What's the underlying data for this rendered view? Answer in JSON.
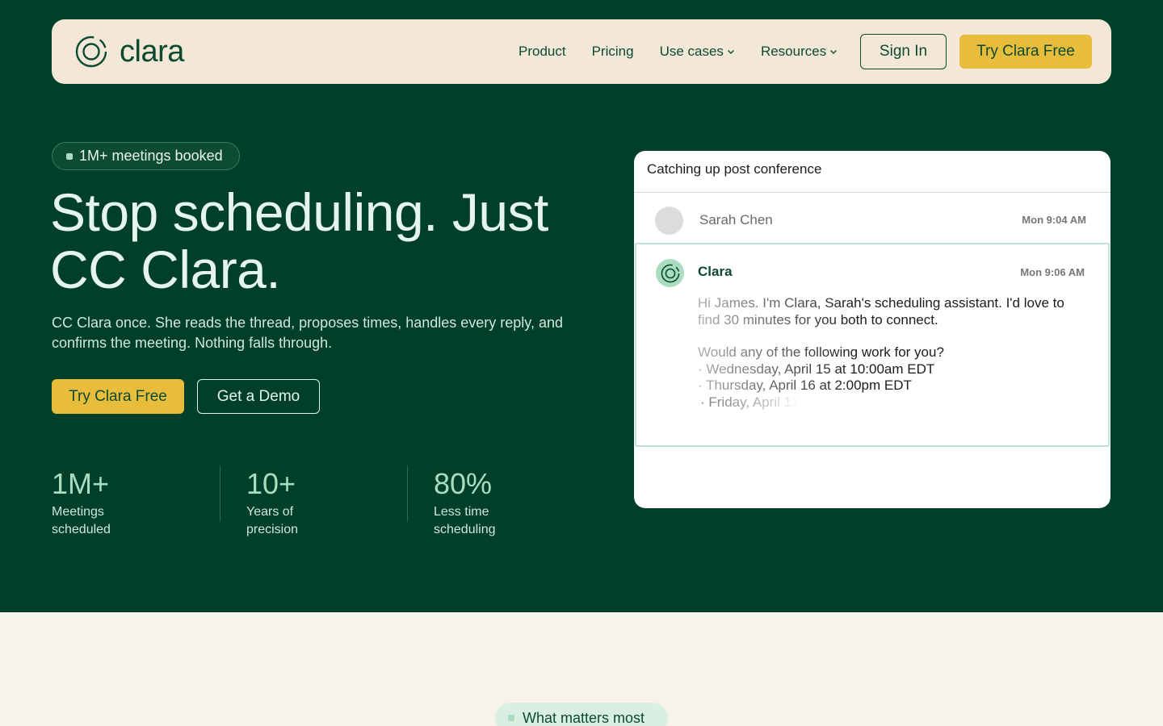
{
  "nav": {
    "brand": "clara",
    "links": [
      {
        "label": "Product",
        "has_dropdown": false
      },
      {
        "label": "Pricing",
        "has_dropdown": false
      },
      {
        "label": "Use cases",
        "has_dropdown": true
      },
      {
        "label": "Resources",
        "has_dropdown": true
      }
    ],
    "sign_in": "Sign In",
    "try_free": "Try Clara Free"
  },
  "hero": {
    "badge": "1M+ meetings booked",
    "title": "Stop scheduling. Just CC Clara.",
    "subtitle": "CC Clara once. She reads the thread, proposes times, handles every reply, and confirms the meeting. Nothing falls through.",
    "cta_primary": "Try Clara Free",
    "cta_secondary": "Get a Demo"
  },
  "stats": [
    {
      "value": "1M+",
      "label": "Meetings scheduled"
    },
    {
      "value": "10+",
      "label": "Years of precision"
    },
    {
      "value": "80%",
      "label": "Less time scheduling"
    }
  ],
  "email": {
    "subject": "Catching up post conference",
    "messages": [
      {
        "sender": "Sarah Chen",
        "time": "Mon 9:04 AM"
      },
      {
        "sender": "Clara",
        "time": "Mon 9:06 AM",
        "lines": [
          "Hi James. I'm Clara, Sarah's scheduling assistant. I'd love to find 30 minutes for you both to connect.",
          "Would any of the following work for you?",
          "· Wednesday, April 15 at 10:00am EDT",
          "· Thursday, April 16 at 2:00pm EDT",
          "· Friday, April 17"
        ]
      }
    ]
  },
  "section2": {
    "pill": "What matters most"
  },
  "colors": {
    "hero_bg": "#00402a",
    "nav_bg": "#f3e8d8",
    "accent_yellow": "#e9bd3c",
    "mint": "#a9dcc0",
    "page_bg": "#f7f2ea"
  }
}
